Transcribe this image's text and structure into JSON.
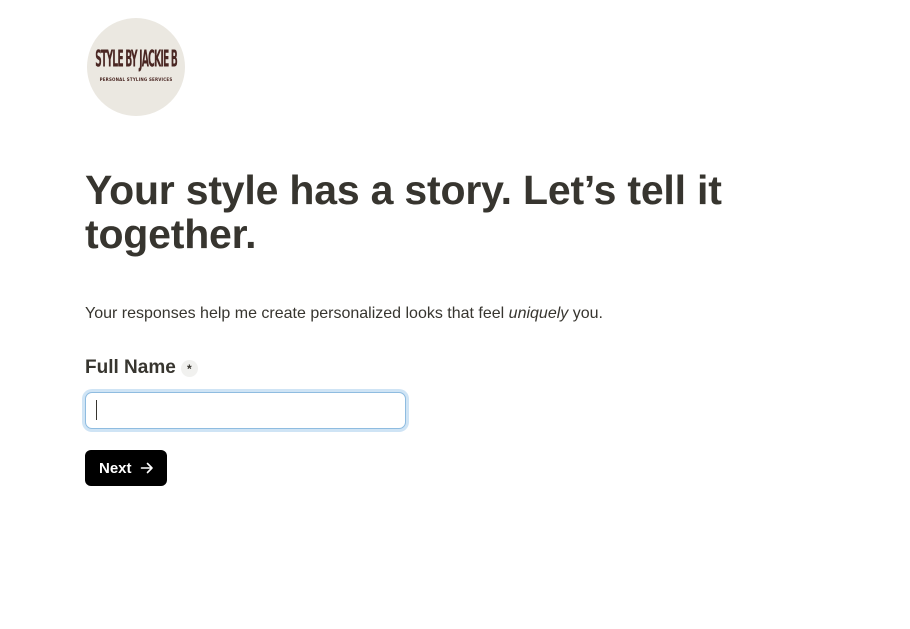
{
  "logo": {
    "main_text": "STYLE BY JACKIE B",
    "sub_text": "PERSONAL STYLING SERVICES"
  },
  "form": {
    "title": "Your style has a story. Let’s tell it together.",
    "description_before": "Your responses help me create personalized looks that feel ",
    "description_emphasis": "uniquely",
    "description_after": " you.",
    "fields": [
      {
        "label": "Full Name",
        "required_marker": "*",
        "value": "",
        "placeholder": ""
      }
    ],
    "next_label": "Next",
    "next_icon": "arrow-right-icon"
  },
  "colors": {
    "text": "#37352f",
    "button_bg": "#000000",
    "button_text": "#ffffff",
    "input_focus": "#8fbce0",
    "logo_bg": "#ebe8e1",
    "logo_text": "#4a2723"
  }
}
